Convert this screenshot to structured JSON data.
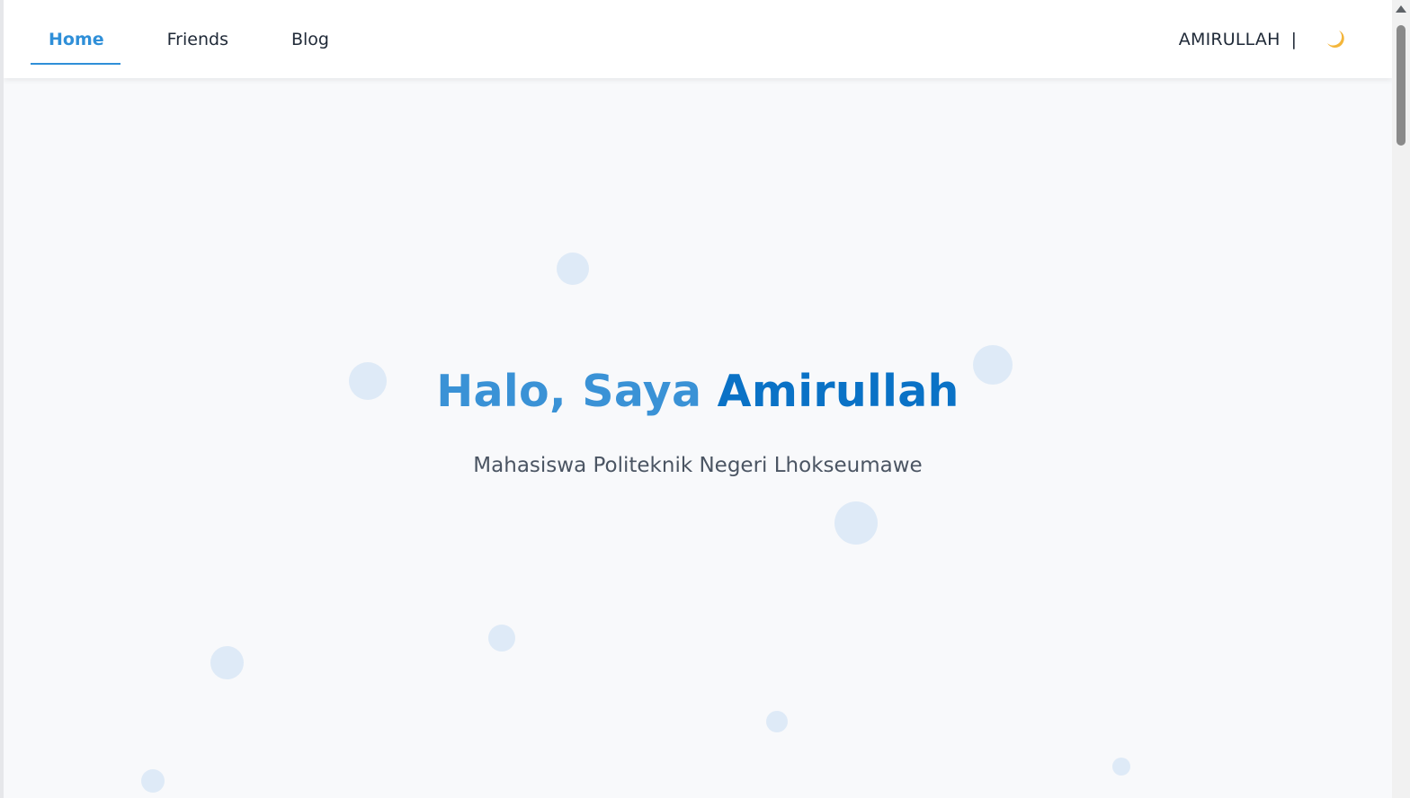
{
  "nav": {
    "links": [
      {
        "label": "Home",
        "active": true
      },
      {
        "label": "Friends",
        "active": false
      },
      {
        "label": "Blog",
        "active": false
      }
    ],
    "brand": "AMIRULLAH",
    "separator": "|",
    "theme_icon": "moon-icon"
  },
  "hero": {
    "title_part1": "Halo, Saya",
    "title_part2": "Amirullah",
    "subtitle": "Mahasiswa Politeknik Negeri Lhokseumawe"
  },
  "colors": {
    "accent": "#2f8fd8",
    "title_dark": "#0a72c6",
    "bubble": "#d9e8f6",
    "background": "#f8f9fb"
  }
}
